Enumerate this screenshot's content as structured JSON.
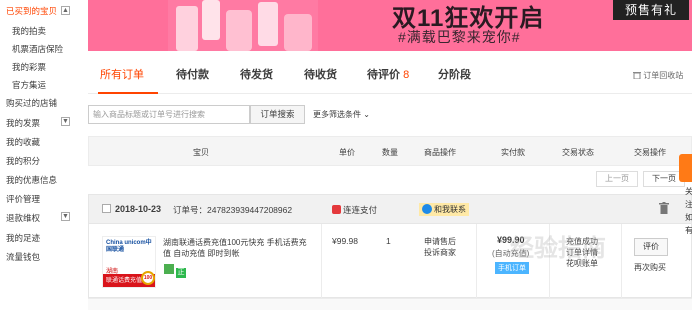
{
  "sidebar": {
    "items": [
      {
        "label": "已买到的宝贝",
        "active": true,
        "toggle": "▲"
      },
      {
        "label": "我的拍卖"
      },
      {
        "label": "机票酒店保险"
      },
      {
        "label": "我的彩票"
      },
      {
        "label": "官方集运"
      },
      {
        "label": "购买过的店铺"
      },
      {
        "label": "我的发票",
        "toggle": "▼"
      },
      {
        "label": "我的收藏"
      },
      {
        "label": "我的积分"
      },
      {
        "label": "我的优惠信息"
      },
      {
        "label": "评价管理"
      },
      {
        "label": "退款维权",
        "toggle": "▼"
      },
      {
        "label": "我的足迹"
      },
      {
        "label": "流量钱包"
      }
    ]
  },
  "banner": {
    "title": "双11狂欢开启",
    "subtitle": "#满载巴黎来宠你#",
    "presale": "预售有礼"
  },
  "tabs": [
    {
      "label": "所有订单",
      "active": true
    },
    {
      "label": "待付款"
    },
    {
      "label": "待发货"
    },
    {
      "label": "待收货"
    },
    {
      "label": "待评价",
      "count": "8"
    },
    {
      "label": "分阶段"
    }
  ],
  "recycle": "订单回收站",
  "search": {
    "placeholder": "输入商品标题或订单号进行搜索",
    "button": "订单搜索",
    "more": "更多筛选条件"
  },
  "table_headers": [
    "宝贝",
    "单价",
    "数量",
    "商品操作",
    "实付款",
    "交易状态",
    "交易操作"
  ],
  "pager": {
    "prev": "上一页",
    "next": "下一页"
  },
  "order": {
    "date": "2018-10-23",
    "order_no": "订单号：247823939447208962",
    "shop": "连连支付",
    "contact": "和我联系",
    "item_title": "湖南联通话费充值100元快充 手机话费充值 自动充值 即时到帐",
    "thumb_logo": "China unicom中国联通",
    "thumb_hunan": "湖南",
    "thumb_bar": "联通话费充值",
    "thumb_coin": "100",
    "badge_text": "正",
    "unit_price": "¥99.98",
    "qty": "1",
    "after_sale": [
      "申请售后",
      "投诉商家"
    ],
    "paid": "¥99.90",
    "paid_note": "(自动充值)",
    "mobile_tag": "手机订单",
    "status": [
      "充值成功",
      "订单详情",
      "花呗账单"
    ],
    "op_button": "评价",
    "op_again": "再次购买"
  },
  "side_float": [
    "关",
    "注",
    "如",
    "有"
  ],
  "watermark": "经验指南"
}
